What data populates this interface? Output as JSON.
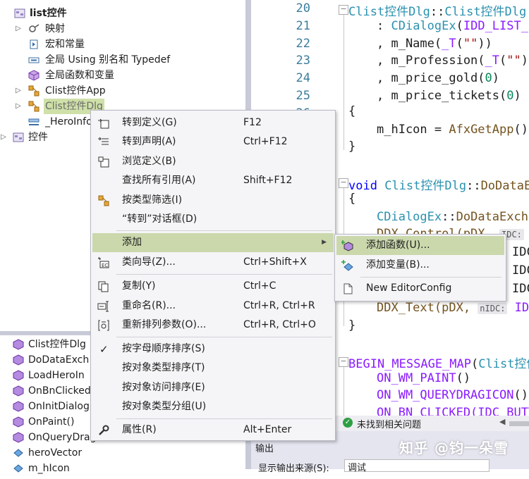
{
  "tree": {
    "items": [
      {
        "label": "list控件",
        "bold": true
      },
      {
        "label": "映射"
      },
      {
        "label": "宏和常量"
      },
      {
        "label": "全局 Using 别名和 Typedef"
      },
      {
        "label": "全局函数和变量"
      },
      {
        "label": "Clist控件App"
      },
      {
        "label": "Clist控件Dlg"
      },
      {
        "label": "_HeroInfo"
      },
      {
        "label": "控件"
      }
    ]
  },
  "members": {
    "items": [
      {
        "label": "Clist控件Dlg"
      },
      {
        "label": "DoDataExch"
      },
      {
        "label": "LoadHeroIn"
      },
      {
        "label": "OnBnClicked"
      },
      {
        "label": "OnInitDialog"
      },
      {
        "label": "OnPaint()"
      },
      {
        "label": "OnQueryDrag"
      },
      {
        "label": "heroVector"
      },
      {
        "label": "m_hIcon"
      }
    ]
  },
  "editor": {
    "line_numbers": [
      "20",
      "21",
      "22",
      "23",
      "24",
      "25",
      "26"
    ],
    "lines": {
      "l20_a": "Clist控件Dlg",
      "l20_b": "::",
      "l20_c": "Clist控件Dlg",
      "l21_a": ": ",
      "l21_b": "CDialogEx",
      "l21_c": "(",
      "l21_d": "IDD_LIST_D",
      "l22_a": ", m_Name(",
      "l22_b": "_T",
      "l22_c": "(",
      "l22_d": "\"\"",
      "l22_e": "))",
      "l23_a": ", m_Profession(",
      "l23_b": "_T",
      "l23_c": "(",
      "l23_d": "\"\"",
      "l23_e": "))",
      "l24_a": ", m_price_gold(",
      "l24_b": "0",
      "l24_c": ")",
      "l25_a": ", m_price_tickets(",
      "l25_b": "0",
      "l25_c": ")",
      "brace_open_1": "{",
      "hicon_a": "m_hIcon = ",
      "hicon_b": "AfxGetApp",
      "hicon_c": "()-",
      "brace_close_1": "}",
      "dde_a": "void ",
      "dde_b": "Clist控件Dlg",
      "dde_c": "::",
      "dde_d": "DoDataE",
      "brace_open_2": "{",
      "dde_call_a": "CDialogEx",
      "dde_call_b": "::",
      "dde_call_c": "DoDataExcha",
      "ddx_ctrl_a": "DDX_Control(pDX, ",
      "ddx_idc_1": "IDC",
      "ddx_idc_2": "IDC",
      "ddx_idc_3": "IDC",
      "ddx_text": "DDX_Text(pDX, ",
      "ddx_text_idc": "IDC",
      "brace_close_2": "}",
      "bmm_a": "BEGIN_MESSAGE_MAP",
      "bmm_b": "(",
      "bmm_c": "Clist控件",
      "wm_paint_a": "ON_WM_PAINT",
      "wm_paint_b": "()",
      "wm_qdi_a": "ON_WM_QUERYDRAGICON",
      "wm_qdi_b": "()",
      "bn_a": "ON_BN_CLICKED(IDC_BUTT"
    },
    "hints": {
      "idc": "IDC:",
      "nidc": "nIDC:"
    }
  },
  "status": {
    "issues": "未找到相关问题"
  },
  "output": {
    "title": "输出",
    "source_label": "显示输出来源(S):",
    "source_value": "调试"
  },
  "context_menu": {
    "items": [
      {
        "label": "转到定义(G)",
        "key": "F12"
      },
      {
        "label": "转到声明(A)",
        "key": "Ctrl+F12"
      },
      {
        "label": "浏览定义(B)",
        "key": ""
      },
      {
        "label": "查找所有引用(A)",
        "key": "Shift+F12"
      },
      {
        "label": "按类型筛选(I)",
        "key": ""
      },
      {
        "label": "“转到”对话框(D)",
        "key": ""
      },
      {
        "label": "添加",
        "key": ""
      },
      {
        "label": "类向导(Z)...",
        "key": "Ctrl+Shift+X"
      },
      {
        "label": "复制(Y)",
        "key": "Ctrl+C"
      },
      {
        "label": "重命名(R)...",
        "key": "Ctrl+R, Ctrl+R"
      },
      {
        "label": "重新排列参数(O)...",
        "key": "Ctrl+R, Ctrl+O"
      },
      {
        "label": "按字母顺序排序(S)",
        "key": ""
      },
      {
        "label": "按对象类型排序(T)",
        "key": ""
      },
      {
        "label": "按对象访问排序(E)",
        "key": ""
      },
      {
        "label": "按对象类型分组(U)",
        "key": ""
      },
      {
        "label": "属性(R)",
        "key": "Alt+Enter"
      }
    ]
  },
  "submenu": {
    "items": [
      {
        "label": "添加函数(U)..."
      },
      {
        "label": "添加变量(B)..."
      },
      {
        "label": "New EditorConfig"
      }
    ]
  },
  "watermark": "知乎 @钧一朵雪",
  "colors": {
    "highlight": "#cad8ac",
    "tree_selection": "#cfe0a8",
    "splitter": "#c9cad8",
    "class_name": "#2b91af",
    "macro": "#8a1bff",
    "string": "#a31515",
    "number": "#098658"
  }
}
